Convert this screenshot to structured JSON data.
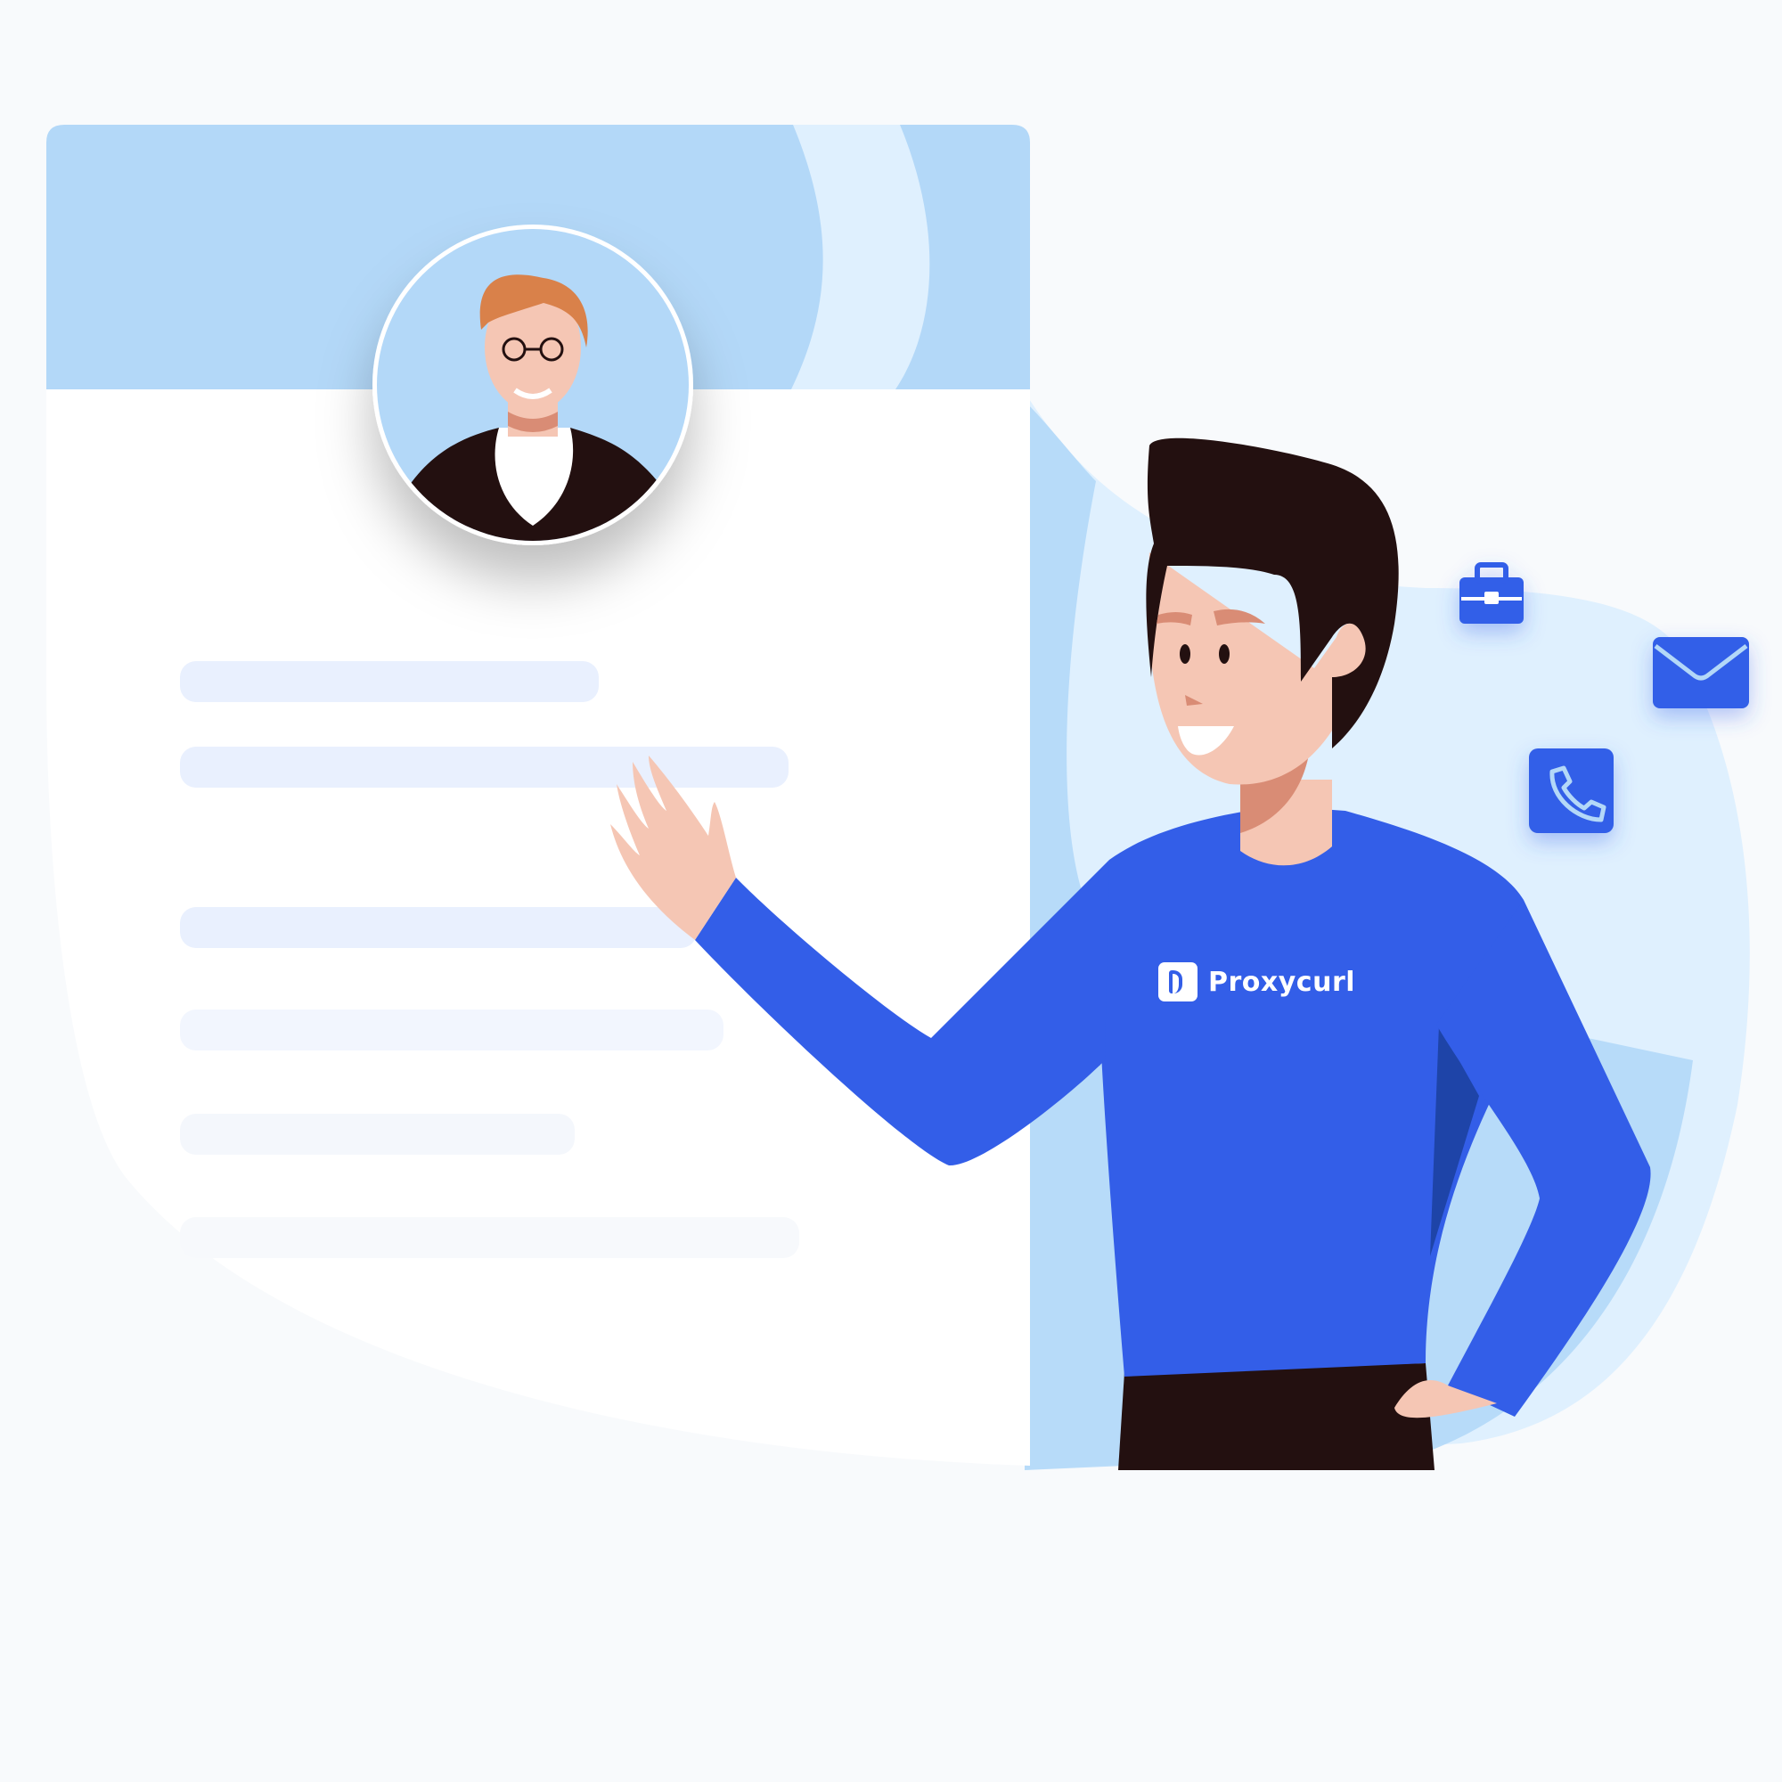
{
  "brand": {
    "name": "Proxycurl"
  },
  "icons": [
    "briefcase-icon",
    "mail-icon",
    "phone-icon"
  ],
  "colors": {
    "background": "#f8fafc",
    "card_header": "#b3d8f8",
    "card_body": "#ffffff",
    "blob_light": "#dff0fe",
    "blob_mid": "#b3d8f8",
    "brand_blue": "#335ee8",
    "brand_blue_dark": "#1e44a8",
    "skin": "#f5c6b4",
    "hair_dark": "#231010",
    "hair_ginger": "#d9814a",
    "placeholder_line": "#e9f0fe"
  }
}
